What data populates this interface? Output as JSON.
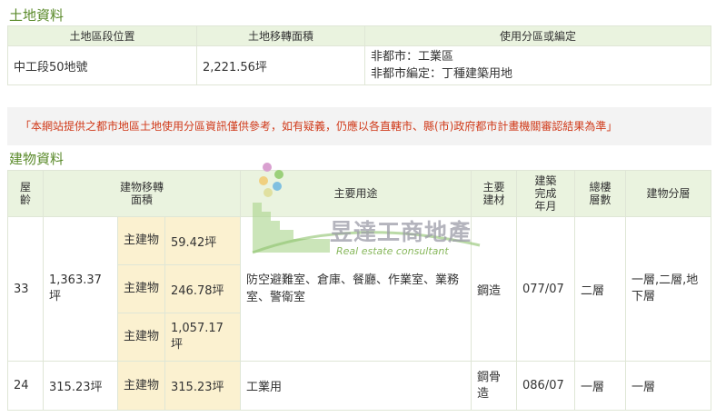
{
  "land": {
    "title": "土地資料",
    "headers": [
      "土地區段位置",
      "土地移轉面積",
      "使用分區或編定"
    ],
    "row": {
      "location": "中工段50地號",
      "area": "2,221.56坪",
      "zoning_1": "非都市：工業區",
      "zoning_2": "非都市編定：丁種建築用地"
    }
  },
  "notice": "「本網站提供之都市地區土地使用分區資訊僅供參考，如有疑義，仍應以各直轄市、縣(市)政府都市計畫機關審認結果為準」",
  "building": {
    "title": "建物資料",
    "headers": {
      "age": "屋齡",
      "transfer_area": "建物移轉面積",
      "usage": "主要用途",
      "material": "主要建材",
      "completed": "建築完成年月",
      "total_floors": "總樓層數",
      "floor_split": "建物分層"
    },
    "rows": [
      {
        "age": "33",
        "total_area": "1,363.37坪",
        "parts": [
          {
            "label": "主建物",
            "area": "59.42坪"
          },
          {
            "label": "主建物",
            "area": "246.78坪"
          },
          {
            "label": "主建物",
            "area": "1,057.17坪"
          }
        ],
        "usage": "防空避難室、倉庫、餐廳、作業室、業務室、警衛室",
        "material": "鋼造",
        "completed": "077/07",
        "floors": "二層",
        "floor_split": "一層,二層,地下層"
      },
      {
        "age": "24",
        "total_area": "315.23坪",
        "parts": [
          {
            "label": "主建物",
            "area": "315.23坪"
          }
        ],
        "usage": "工業用",
        "material": "鋼骨造",
        "completed": "086/07",
        "floors": "一層",
        "floor_split": "一層"
      }
    ]
  },
  "watermark": {
    "brand": "昱達工商地產",
    "tagline": "Real estate consultant"
  }
}
